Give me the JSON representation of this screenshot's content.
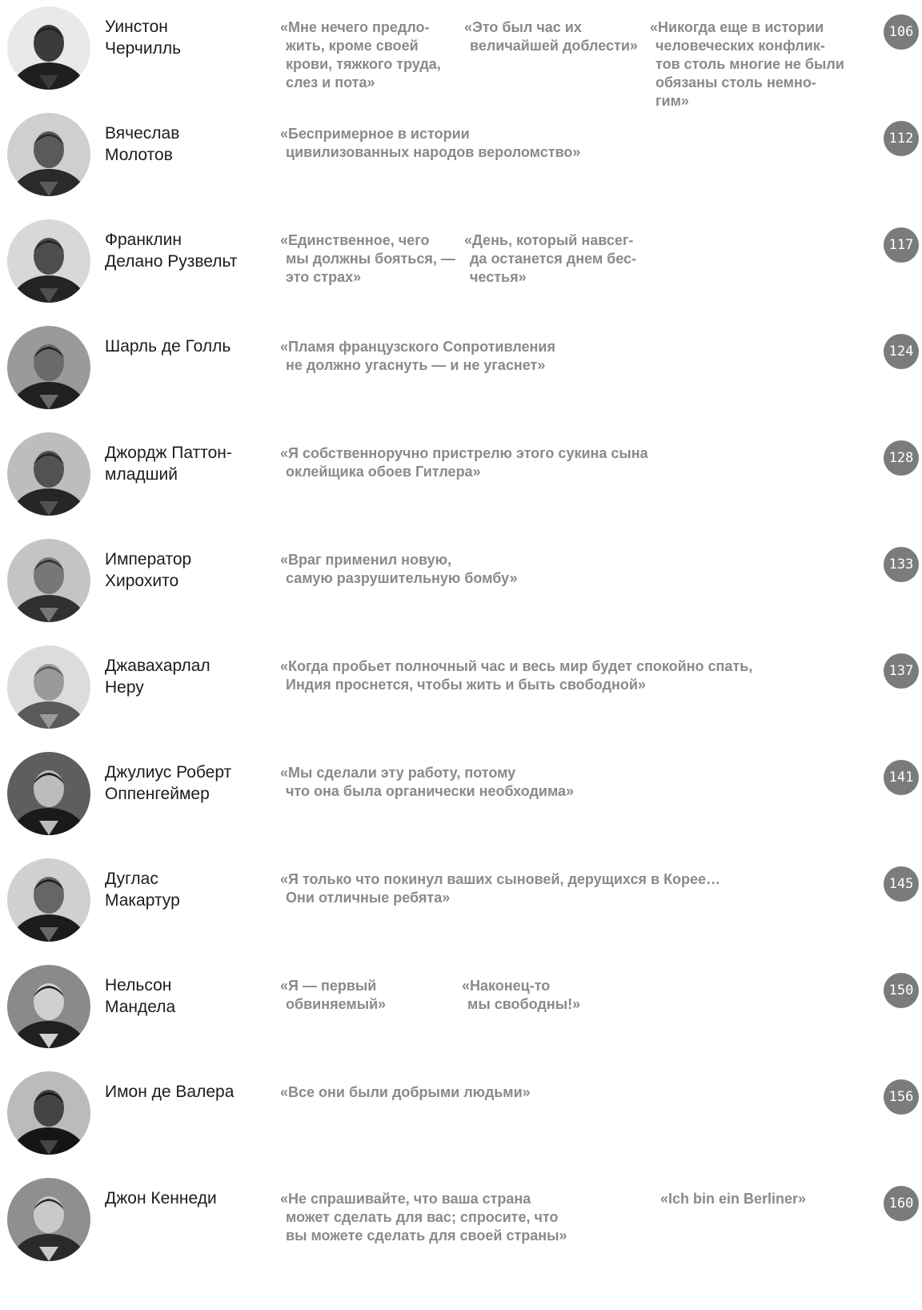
{
  "entries": [
    {
      "name": [
        "Уинстон",
        "Черчилль"
      ],
      "quotes": [
        [
          "«Мне нечего предло-",
          "жить, кроме своей",
          "крови, тяжкого труда,",
          "слез и пота»"
        ],
        [
          "«Это был час их",
          "величайшей доблести»"
        ],
        [
          "«Никогда еще в истории",
          "человеческих конфлик-",
          "тов столь многие не были",
          "обязаны столь немно-",
          "гим»"
        ]
      ],
      "page": "106"
    },
    {
      "name": [
        "Вячеслав",
        "Молотов"
      ],
      "quotes": [
        [
          "«Беспримерное в истории",
          "цивилизованных народов вероломство»"
        ]
      ],
      "page": "112"
    },
    {
      "name": [
        "Франклин",
        "Делано Рузвельт"
      ],
      "quotes": [
        [
          "«Единственное, чего",
          "мы должны бояться, —",
          "это страх»"
        ],
        [
          "«День, который навсег-",
          "да останется днем бес-",
          "честья»"
        ]
      ],
      "page": "117"
    },
    {
      "name": [
        "Шарль де Голль"
      ],
      "quotes": [
        [
          "«Пламя французского Сопротивления",
          "не должно угаснуть — и не угаснет»"
        ]
      ],
      "page": "124"
    },
    {
      "name": [
        "Джордж Паттон-",
        "младший"
      ],
      "quotes": [
        [
          "«Я собственноручно пристрелю этого сукина сына",
          "оклейщика обоев Гитлера»"
        ]
      ],
      "page": "128"
    },
    {
      "name": [
        "Император",
        "Хирохито"
      ],
      "quotes": [
        [
          "«Враг применил новую,",
          "самую разрушительную бомбу»"
        ]
      ],
      "page": "133"
    },
    {
      "name": [
        "Джавахарлал",
        "Неру"
      ],
      "quotes": [
        [
          "«Когда пробьет полночный час и весь мир будет спокойно спать,",
          "Индия проснется, чтобы жить и быть свободной»"
        ]
      ],
      "page": "137"
    },
    {
      "name": [
        "Джулиус Роберт",
        "Оппенгеймер"
      ],
      "quotes": [
        [
          "«Мы сделали эту работу, потому",
          "что она была органически необходима»"
        ]
      ],
      "page": "141"
    },
    {
      "name": [
        "Дуглас",
        "Макартур"
      ],
      "quotes": [
        [
          "«Я только что покинул ваших сыновей, дерущихся в Корее…",
          "Они отличные ребята»"
        ]
      ],
      "page": "145"
    },
    {
      "name": [
        "Нельсон",
        "Мандела"
      ],
      "quotes": [
        [
          "«Я — первый",
          "обвиняемый»"
        ],
        [
          "«Наконец-то",
          "мы свободны!»"
        ]
      ],
      "page": "150"
    },
    {
      "name": [
        "Имон де Валера"
      ],
      "quotes": [
        [
          "«Все они были добрыми людьми»"
        ]
      ],
      "page": "156"
    },
    {
      "name": [
        "Джон Кеннеди"
      ],
      "quotes": [
        [
          "«Не спрашивайте, что ваша страна",
          "может сделать для вас; спросите, что",
          "вы можете сделать для своей страны»"
        ],
        [
          "«Ich bin ein Berliner»"
        ]
      ],
      "page": "160"
    }
  ]
}
